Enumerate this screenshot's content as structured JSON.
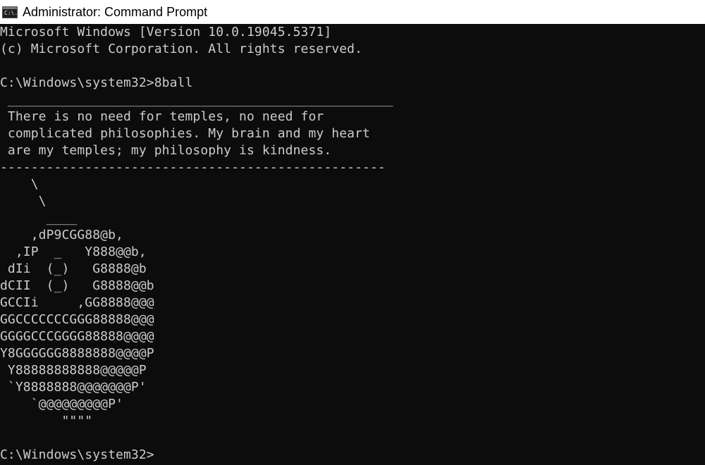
{
  "window": {
    "title": "Administrator: Command Prompt",
    "icon": "cmd-icon",
    "icon_text": "C:\\."
  },
  "console": {
    "banner_line1": "Microsoft Windows [Version 10.0.19045.5371]",
    "banner_line2": "(c) Microsoft Corporation. All rights reserved.",
    "prompt": "C:\\Windows\\system32>",
    "command": "8ball",
    "speech_top": " __________________________________________________",
    "quote_lines": [
      " There is no need for temples, no need for",
      " complicated philosophies. My brain and my heart",
      " are my temples; my philosophy is kindness."
    ],
    "speech_bottom": "--------------------------------------------------",
    "ascii_art": [
      "    \\",
      "     \\",
      "      ____",
      "    ,dP9CGG88@b,",
      "  ,IP  _   Y888@@b,",
      " dIi  (_)   G8888@b",
      "dCII  (_)   G8888@@b",
      "GCCIi     ,GG8888@@@",
      "GGCCCCCCCGGG88888@@@",
      "GGGGCCCGGGG88888@@@@",
      "Y8GGGGGG8888888@@@@P",
      " Y88888888888@@@@@P",
      " `Y8888888@@@@@@@P'",
      "    `@@@@@@@@@P'",
      "        \"\"\"\""
    ],
    "final_prompt": "C:\\Windows\\system32>"
  },
  "colors": {
    "background": "#0c0c0c",
    "foreground": "#cccccc",
    "titlebar": "#ffffff"
  }
}
